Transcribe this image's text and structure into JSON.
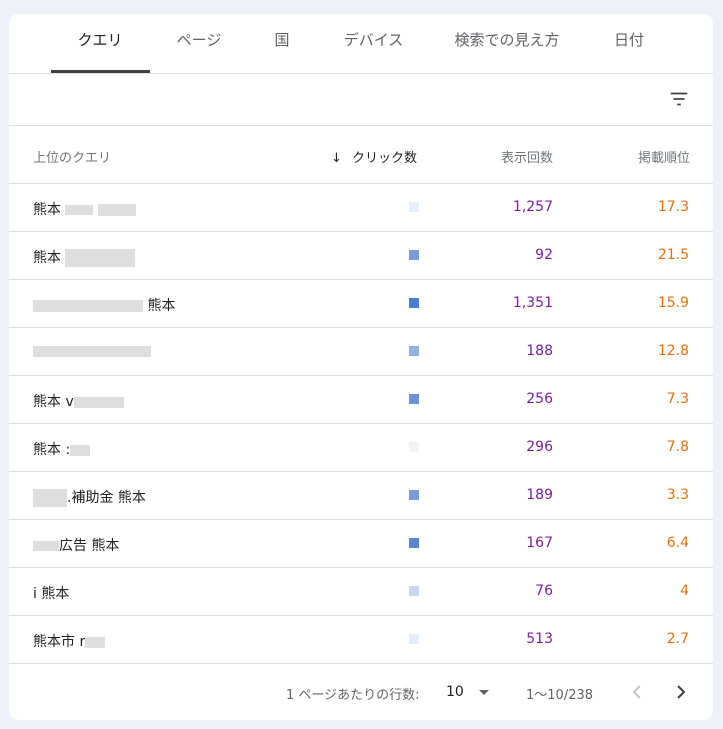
{
  "tabs": [
    {
      "label": "クエリ",
      "active": true
    },
    {
      "label": "ページ"
    },
    {
      "label": "国"
    },
    {
      "label": "デバイス"
    },
    {
      "label": "検索での見え方"
    },
    {
      "label": "日付"
    }
  ],
  "table": {
    "columns": [
      "上位のクエリ",
      "クリック数",
      "表示回数",
      "掲載順位"
    ],
    "sort_indicator": "↓",
    "rows": [
      {
        "query": "熊本",
        "impressions": "1,257",
        "position": "17.3",
        "click_color": "#e8eef9"
      },
      {
        "query": "熊本",
        "impressions": "92",
        "position": "21.5",
        "click_color": "#7d9bd6"
      },
      {
        "query": "熊本",
        "impressions": "1,351",
        "position": "15.9",
        "click_color": "#4a7fd0"
      },
      {
        "query": "",
        "impressions": "188",
        "position": "12.8",
        "click_color": "#94b0e0"
      },
      {
        "query": "熊本 v",
        "impressions": "256",
        "position": "7.3",
        "click_color": "#6e92d6"
      },
      {
        "query": "熊本 :",
        "impressions": "296",
        "position": "7.8",
        "click_color": "#f2f2f4"
      },
      {
        "query": ".補助金 熊本",
        "impressions": "189",
        "position": "3.3",
        "click_color": "#7d9bd6"
      },
      {
        "query": "広告 熊本",
        "impressions": "167",
        "position": "6.4",
        "click_color": "#5b87d2"
      },
      {
        "query": "i 熊本",
        "impressions": "76",
        "position": "4",
        "click_color": "#c9d7ee"
      },
      {
        "query": "熊本市 r",
        "impressions": "513",
        "position": "2.7",
        "click_color": "#e6ecf8"
      }
    ]
  },
  "footer": {
    "rows_per_page_label": "1 ページあたりの行数:",
    "rows_per_page_value": "10",
    "range": "1〜10/238"
  },
  "colors": {
    "impressions": "#7b1fa2",
    "position": "#e8710a",
    "clicks": "#4285f4"
  }
}
